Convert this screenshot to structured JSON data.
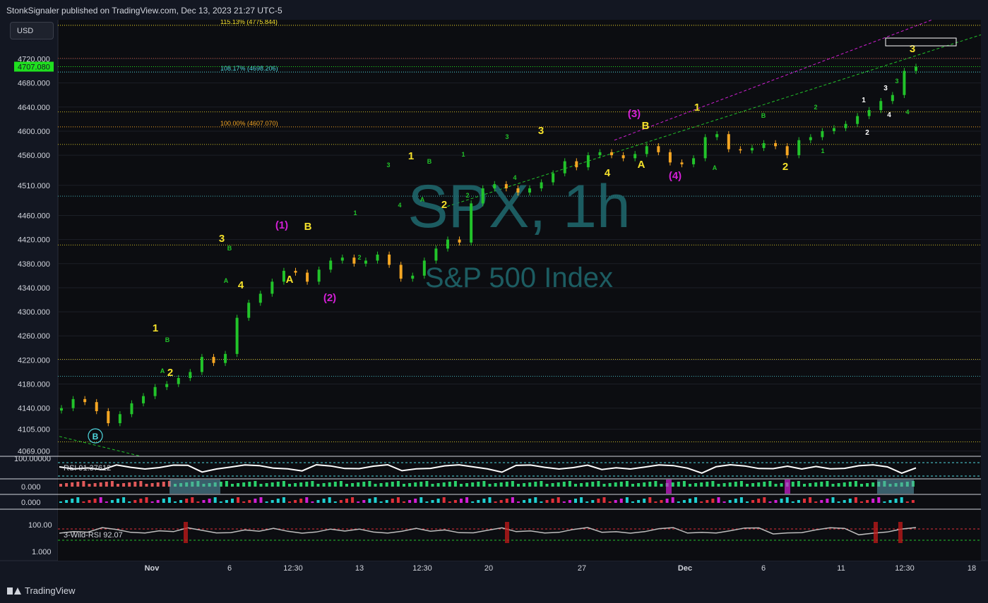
{
  "header": {
    "publisher_line": "StonkSignaler published on TradingView.com, Dec 13, 2023 21:27 UTC-5"
  },
  "toolbar": {
    "currency": "USD"
  },
  "watermark": {
    "symbol": "SPX, 1h",
    "name": "S&P 500 Index"
  },
  "footer": {
    "brand": "TradingView"
  },
  "colors": {
    "background": "#131722",
    "up": "#22c32a",
    "down": "#f5a623",
    "wave_yellow": "#f5e12b",
    "wave_magenta": "#d21fd5",
    "wave_green": "#22c32a",
    "price_tag": "#1fdf1f"
  },
  "chart_data": [
    {
      "type": "line",
      "title": "SPX, 1h",
      "subtitle": "S&P 500 Index",
      "xlabel": "",
      "ylabel": "",
      "ylim": [
        4060,
        4785
      ],
      "x_tick_labels": [
        "Nov",
        "6",
        "12:30",
        "13",
        "12:30",
        "20",
        "27",
        "Dec",
        "6",
        "11",
        "12:30",
        "18"
      ],
      "y_tick_labels": [
        "4720.000",
        "4680.000",
        "4640.000",
        "4600.000",
        "4560.000",
        "4510.000",
        "4460.000",
        "4420.000",
        "4380.000",
        "4340.000",
        "4300.000",
        "4260.000",
        "4220.000",
        "4180.000",
        "4140.000",
        "4105.000",
        "4069.000"
      ],
      "y_ticks": [
        4720,
        4680,
        4640,
        4600,
        4560,
        4510,
        4460,
        4420,
        4380,
        4340,
        4300,
        4260,
        4220,
        4180,
        4140,
        4105,
        4069
      ],
      "last_price_label": "4707.080",
      "last_price": 4707.08,
      "series": [
        {
          "values": [
            4140,
            4155,
            4150,
            4135,
            4115,
            4130,
            4148,
            4160,
            4175,
            4180,
            4190,
            4200,
            4225,
            4215,
            4230,
            4290,
            4315,
            4330,
            4350,
            4368,
            4365,
            4350,
            4370,
            4385,
            4390,
            4380,
            4385,
            4395,
            4378,
            4355,
            4360,
            4385,
            4405,
            4420,
            4415,
            4480,
            4505,
            4512,
            4505,
            4498,
            4505,
            4515,
            4530,
            4550,
            4540,
            4560,
            4565,
            4560,
            4555,
            4562,
            4575,
            4565,
            4548,
            4545,
            4555,
            4590,
            4595,
            4570,
            4568,
            4572,
            4580,
            4575,
            4560,
            4585,
            4590,
            4600,
            4605,
            4612,
            4625,
            4635,
            4650,
            4660,
            4700,
            4707
          ]
        }
      ],
      "fib_levels": [
        {
          "label": "115.13% (4775.844)",
          "value": 4775.844,
          "color": "#f5e12b"
        },
        {
          "label": "108.17% (4698.206)",
          "value": 4698.206,
          "color": "#4fd8e0"
        },
        {
          "label": "100.00% (4607.070)",
          "value": 4607.07,
          "color": "#f5a623"
        }
      ],
      "wave_labels": [
        {
          "text": "B",
          "color": "#4fd8e0"
        },
        {
          "text": "1",
          "color": "#f5e12b"
        },
        {
          "text": "2",
          "color": "#f5e12b"
        },
        {
          "text": "A",
          "color": "#22c32a"
        },
        {
          "text": "B",
          "color": "#22c32a"
        },
        {
          "text": "3",
          "color": "#f5e12b"
        },
        {
          "text": "B",
          "color": "#22c32a"
        },
        {
          "text": "A",
          "color": "#22c32a"
        },
        {
          "text": "4",
          "color": "#f5e12b"
        },
        {
          "text": "(1)",
          "color": "#d21fd5"
        },
        {
          "text": "B",
          "color": "#f5e12b"
        },
        {
          "text": "A",
          "color": "#f5e12b"
        },
        {
          "text": "(2)",
          "color": "#d21fd5"
        },
        {
          "text": "1",
          "color": "#22c32a"
        },
        {
          "text": "2",
          "color": "#22c32a"
        },
        {
          "text": "3",
          "color": "#22c32a"
        },
        {
          "text": "4",
          "color": "#22c32a"
        },
        {
          "text": "1",
          "color": "#f5e12b"
        },
        {
          "text": "B",
          "color": "#22c32a"
        },
        {
          "text": "A",
          "color": "#22c32a"
        },
        {
          "text": "2",
          "color": "#f5e12b"
        },
        {
          "text": "1",
          "color": "#22c32a"
        },
        {
          "text": "2",
          "color": "#22c32a"
        },
        {
          "text": "3",
          "color": "#22c32a"
        },
        {
          "text": "4",
          "color": "#22c32a"
        },
        {
          "text": "3",
          "color": "#f5e12b"
        },
        {
          "text": "4",
          "color": "#f5e12b"
        },
        {
          "text": "(3)",
          "color": "#d21fd5"
        },
        {
          "text": "B",
          "color": "#f5e12b"
        },
        {
          "text": "A",
          "color": "#f5e12b"
        },
        {
          "text": "(4)",
          "color": "#d21fd5"
        },
        {
          "text": "1",
          "color": "#f5e12b"
        },
        {
          "text": "A",
          "color": "#22c32a"
        },
        {
          "text": "B",
          "color": "#22c32a"
        },
        {
          "text": "2",
          "color": "#f5e12b"
        },
        {
          "text": "1",
          "color": "#22c32a"
        },
        {
          "text": "2",
          "color": "#22c32a"
        },
        {
          "text": "1",
          "color": "#ffffff"
        },
        {
          "text": "2",
          "color": "#ffffff"
        },
        {
          "text": "3",
          "color": "#ffffff"
        },
        {
          "text": "4",
          "color": "#ffffff"
        },
        {
          "text": "3",
          "color": "#22c32a"
        },
        {
          "text": "4",
          "color": "#22c32a"
        },
        {
          "text": "3",
          "color": "#f5e12b"
        }
      ]
    },
    {
      "type": "line",
      "title": "RSI",
      "legend_text": "RSI  91.37612",
      "value": 91.37612,
      "scale_label": "100.00000"
    },
    {
      "type": "bar",
      "title": "",
      "scale_label": "0.000"
    },
    {
      "type": "bar",
      "title": "",
      "scale_label": "0.000"
    },
    {
      "type": "line",
      "title": "3-Wild-RSI",
      "legend_text": "3-Wild-RSI  92.07",
      "value": 92.07,
      "scale_labels": [
        "100.00",
        "1.000"
      ]
    }
  ]
}
